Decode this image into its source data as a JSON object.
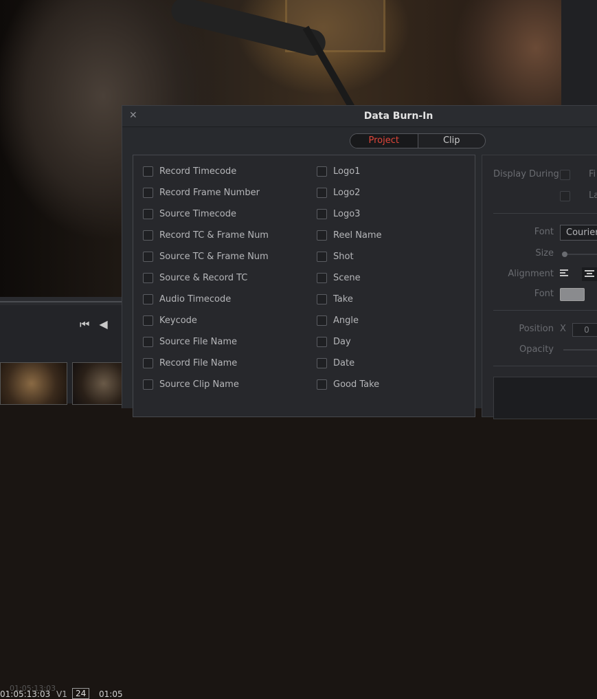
{
  "editor": {
    "faint_timecode": "01:05:13:03",
    "timecode": "01:05:13:03",
    "track": "V1",
    "fps": "24",
    "timecode_right": "01:05"
  },
  "dialog": {
    "title": "Data Burn-In",
    "tabs": [
      {
        "label": "Project",
        "active": true
      },
      {
        "label": "Clip",
        "active": false
      }
    ],
    "left_column": [
      "Record Timecode",
      "Record Frame Number",
      "Source Timecode",
      "Record TC & Frame Num",
      "Source TC & Frame Num",
      "Source & Record TC",
      "Audio Timecode",
      "Keycode",
      "Source File Name",
      "Record File Name",
      "Source Clip Name"
    ],
    "right_column": [
      "Logo1",
      "Logo2",
      "Logo3",
      "Reel Name",
      "Shot",
      "Scene",
      "Take",
      "Angle",
      "Day",
      "Date",
      "Good Take"
    ],
    "settings": {
      "display_during": "Display During",
      "display_first": "Fi",
      "display_last": "La",
      "font_label": "Font",
      "font_value": "Courier",
      "size_label": "Size",
      "alignment_label": "Alignment",
      "font_color_label": "Font",
      "position_label": "Position",
      "position_axis": "X",
      "position_value": "0",
      "opacity_label": "Opacity"
    },
    "colors": {
      "accent": "#e0463a",
      "font_swatch": "#8a8b8e"
    }
  }
}
